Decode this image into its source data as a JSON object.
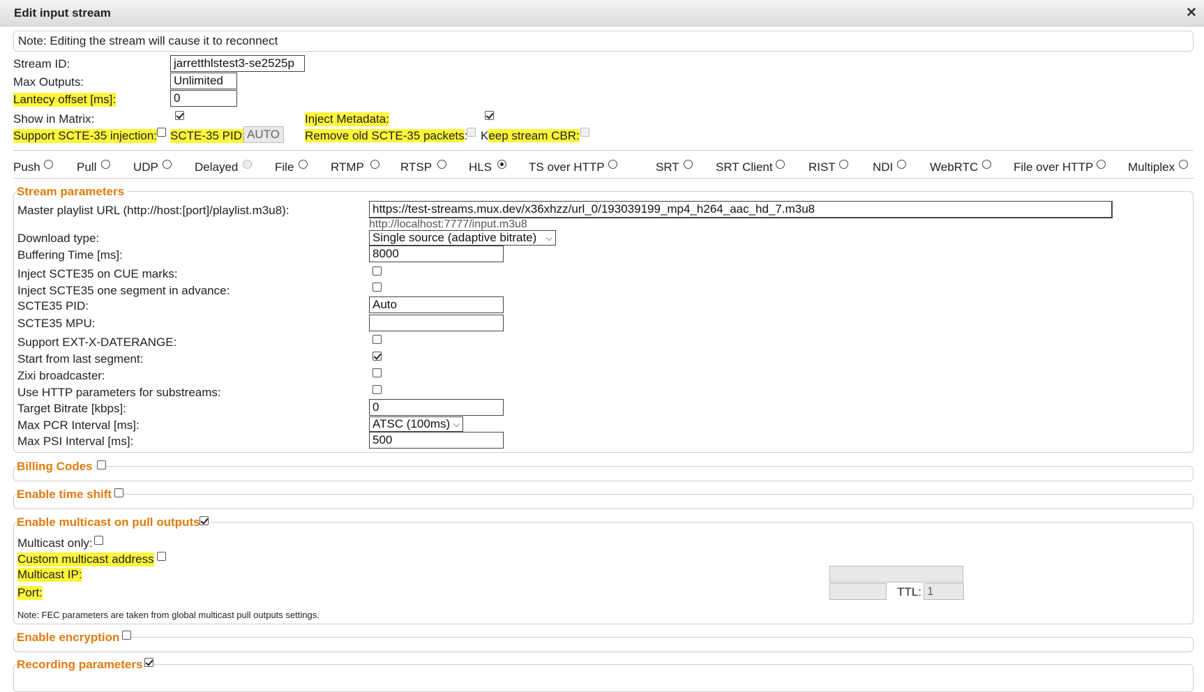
{
  "dialog": {
    "title": "Edit input stream"
  },
  "note": "Note: Editing the stream will cause it to reconnect",
  "top": {
    "stream_id_label": "Stream ID:",
    "stream_id_value": "jarretthlstest3-se2525p",
    "max_outputs_label": "Max Outputs:",
    "max_outputs_value": "Unlimited",
    "latency_label": "Lantecy offset [ms]:",
    "latency_value": "0",
    "show_in_matrix_label": "Show in Matrix:",
    "inject_metadata_label": "Inject Metadata:",
    "support_scte_label": "Support SCTE-35 injection:",
    "scte_pid_label": "SCTE-35 PID:",
    "scte_pid_value": "AUTO",
    "remove_old_scte_label": "Remove old SCTE-35 packets",
    "remove_old_scte_colon": ":",
    "keep_cbr_prefix": "K",
    "keep_cbr_label": "eep stream CBR:"
  },
  "stream_types": [
    {
      "label": "Push"
    },
    {
      "label": "Pull"
    },
    {
      "label": "UDP"
    },
    {
      "label": "Delayed"
    },
    {
      "label": "File"
    },
    {
      "label": "RTMP"
    },
    {
      "label": "RTSP"
    },
    {
      "label": "HLS"
    },
    {
      "label": "TS over HTTP"
    },
    {
      "label": "SRT"
    },
    {
      "label": "SRT Client"
    },
    {
      "label": "RIST"
    },
    {
      "label": "NDI"
    },
    {
      "label": "WebRTC"
    },
    {
      "label": "File over HTTP"
    },
    {
      "label": "Multiplex"
    }
  ],
  "stream_params": {
    "legend": "Stream parameters",
    "master_url_label": "Master playlist URL (http://host:[port]/playlist.m3u8):",
    "master_url_value": "https://test-streams.mux.dev/x36xhzz/url_0/193039199_mp4_h264_aac_hd_7.m3u8",
    "master_url_hint": "http://localhost:7777/input.m3u8",
    "download_type_label": "Download type:",
    "download_type_value": "Single source (adaptive bitrate)",
    "buffering_label": "Buffering Time [ms]:",
    "buffering_value": "8000",
    "inject_cue_label": "Inject SCTE35 on CUE marks:",
    "inject_advance_label": "Inject SCTE35 one segment in advance:",
    "scte35_pid_label": "SCTE35 PID:",
    "scte35_pid_value": "Auto",
    "scte35_mpu_label": "SCTE35 MPU:",
    "scte35_mpu_value": "",
    "ext_daterange_label": "Support EXT-X-DATERANGE:",
    "start_last_label": "Start from last segment:",
    "zixi_label": "Zixi broadcaster:",
    "http_params_label": "Use HTTP parameters for substreams:",
    "target_bitrate_label": "Target Bitrate [kbps]:",
    "target_bitrate_value": "0",
    "max_pcr_label": "Max PCR Interval [ms]:",
    "max_pcr_value": "ATSC (100ms)",
    "max_psi_label": "Max PSI Interval [ms]:",
    "max_psi_value": "500"
  },
  "billing": {
    "legend": "Billing Codes"
  },
  "timeshift": {
    "legend": "Enable time shift"
  },
  "multicast": {
    "legend": "Enable multicast on pull outputs",
    "only_label": "Multicast only:",
    "custom_label": "Custom multicast address",
    "ip_label": "Multicast IP:",
    "port_label": "Port:",
    "ttl_label": "TTL:",
    "ttl_value": "1",
    "ip_value": "",
    "port_value": "",
    "note": "Note: FEC parameters are taken from global multicast pull outputs settings."
  },
  "encryption": {
    "legend": "Enable encryption"
  },
  "recording": {
    "legend": "Recording parameters"
  }
}
